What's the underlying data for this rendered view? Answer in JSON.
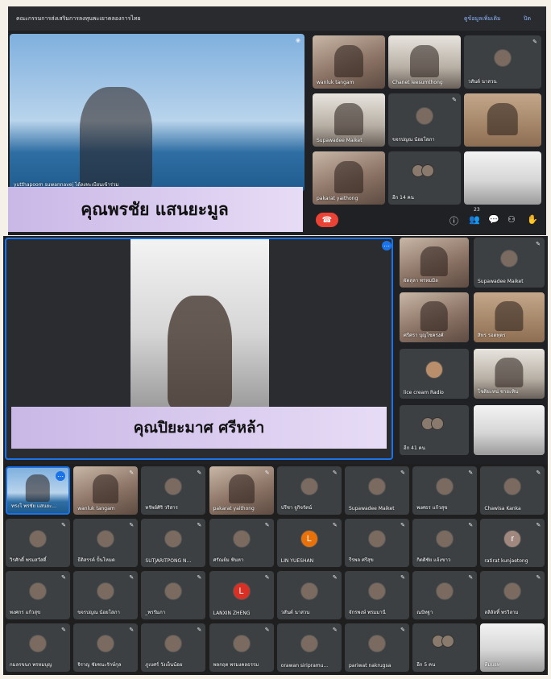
{
  "top": {
    "title": "คณะกรรมการส่งเสริมการลงทุนพะเยาคลองการไทย",
    "link_1": "ดูข้อมูลเพิ่มเติม",
    "link_2": "ปิด",
    "speaker_name": "yutthapoom suwannavej ได้ลงทะเบียนเข้าร่วม",
    "caption": "คุณพรชัย แสนยะมูล",
    "tiles": [
      "wanluk tangam",
      "Chanet leesumthong",
      "วสันต์ นาสวน",
      "Supawadee Maiket",
      "ขจรปญณ น้อยโสภา",
      "",
      "pakarat yaithong",
      "อีก 14 คน",
      ""
    ],
    "controls": {
      "people_count": "23",
      "info": "ⓘ",
      "people": "👥",
      "chat": "💬",
      "activities": "⚇",
      "raise": "✋"
    }
  },
  "mid": {
    "caption": "คุณปิยะมาศ ศรีหล้า",
    "side_tiles": [
      "ผัดสุลา พรหมมิล",
      "Supawadee Maiket",
      "ศรีศรา บุญโชครงศ์",
      "สิทร รอดทุตร",
      "lice cream Radio",
      "โชติยะหน่ ชายะทิน",
      "อีก 41 คน",
      ""
    ]
  },
  "bottom": {
    "tiles": [
      "ทรงโ พรชัย แสนยะ...",
      "wanluk tangam",
      "ทรัพย์ศิริ วริสาร",
      "pakarat yaithong",
      "ปรีชา จูกิจรัตน์",
      "Supawadee Maiket",
      "พงศธร แก้วสุข",
      "Chawisa Kanka",
      "วิรศักดิ์ พรมสวัสดิ์",
      "ธีติสรรค์ ปั้นโหมด",
      "SUTJARITPONG N...",
      "ศรัณย์ม ฟันหา",
      "LIN YUESHAN",
      "รีรพล ศรีสุข",
      "กิตติชัย แจ้งขาว",
      "ratirat kunjaetong",
      "พงศกร แก้วสุข",
      "ขจรปญณ น้อยโสภา",
      "_พรรัมภา",
      "LANXIN ZHENG",
      "วสันต์ นาสวน",
      "จักรพงษ์ พรมมานี",
      "ณปัทฐา",
      "ลลิลัลทิ์ พรวิลาม",
      "กมลรขนก พรหมบุญ",
      "จิราญ ชัยชนะรักษ์กุล",
      "ภูเบศร์ วังเย็นน้อย",
      "พลกฤต พรมงคลธรรม",
      "orawan siripramu...",
      "pariwat nakrugsa",
      "อีก 5 คน",
      "ทีมบอท"
    ],
    "letters": {
      "lin": "L",
      "ratirat": "r",
      "lanxin": "L"
    }
  },
  "colors": {
    "panel": "#202124",
    "caption_bg": "#d4c6ee",
    "hangup": "#ea4335",
    "accent": "#1a73e8"
  }
}
